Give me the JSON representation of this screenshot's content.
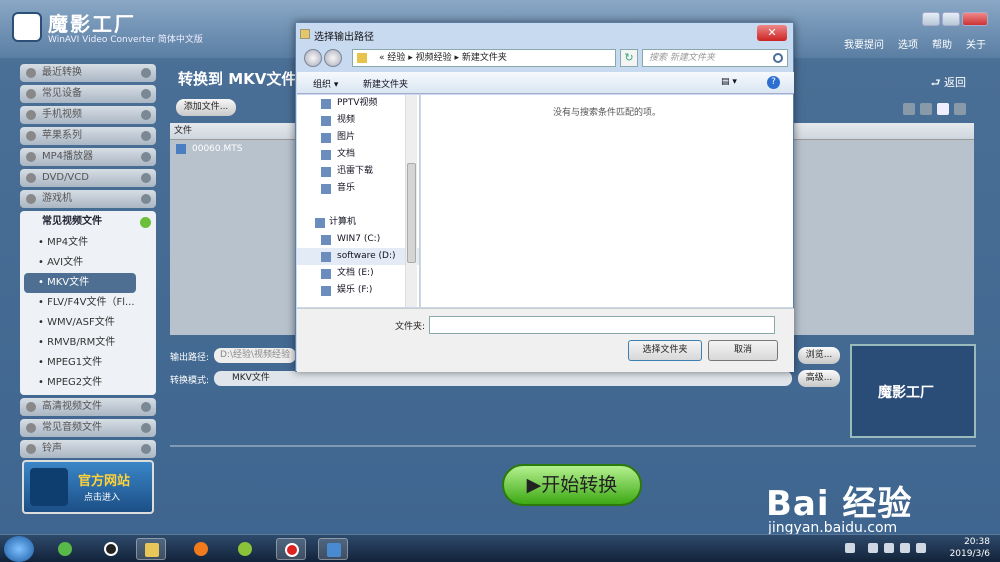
{
  "app": {
    "title": "魔影工厂",
    "subtitle": "WinAVI Video Converter 简体中文版",
    "menu": [
      "我要提问",
      "选项",
      "帮助",
      "关于"
    ]
  },
  "sidebar": {
    "items_top": [
      "最近转换",
      "常见设备",
      "手机视频",
      "苹果系列",
      "MP4播放器",
      "DVD/VCD",
      "游戏机"
    ],
    "open_header": "常见视频文件",
    "sub_items": [
      "• MP4文件",
      "• AVI文件",
      "• MKV文件",
      "• FLV/F4V文件（Fl...",
      "• WMV/ASF文件",
      "• RMVB/RM文件",
      "• MPEG1文件",
      "• MPEG2文件"
    ],
    "items_bottom": [
      "高清视频文件",
      "常见音频文件",
      "铃声"
    ],
    "promo_title": "官方网站",
    "promo_sub": "点击进入"
  },
  "main": {
    "title": "转换到 MKV文件",
    "back": "返回",
    "add_file": "添加文件...",
    "list_header": "文件",
    "files": [
      "00060.MTS"
    ],
    "output_label": "输出路径:",
    "output_path": "D:\\经验\\视频经验\\新",
    "mode_label": "转换模式:",
    "mode_value": "MKV文件",
    "browse": "浏览...",
    "advanced": "高级...",
    "preview_text": "魔影工厂",
    "start": "开始转换"
  },
  "dialog": {
    "title": "选择输出路径",
    "close": "✕",
    "breadcrumb": "«  经验  ▸  视频经验  ▸  新建文件夹",
    "search_placeholder": "搜索 新建文件夹",
    "organize": "组织 ▾",
    "new_folder": "新建文件夹",
    "tree": [
      "PPTV视频",
      "视频",
      "图片",
      "文档",
      "迅雷下载",
      "音乐"
    ],
    "computer": "计算机",
    "drives": [
      "WIN7 (C:)",
      "software (D:)",
      "文档 (E:)",
      "娱乐 (F:)"
    ],
    "empty_text": "没有与搜索条件匹配的项。",
    "folder_label": "文件夹:",
    "folder_value": "",
    "select_button": "选择文件夹",
    "cancel_button": "取消"
  },
  "taskbar": {
    "time": "20:38",
    "date": "2019/3/6"
  },
  "watermark": {
    "text": "Bai 经验",
    "url": "jingyan.baidu.com"
  }
}
